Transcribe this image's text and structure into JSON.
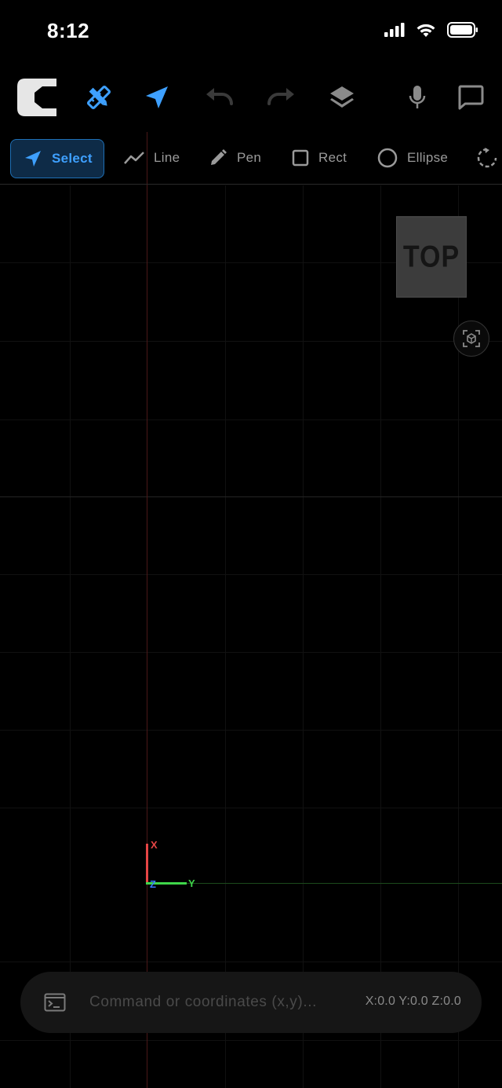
{
  "status_bar": {
    "time": "8:12"
  },
  "toolbar": {
    "buttons": [
      {
        "name": "app-logo",
        "icon": "logo-c"
      },
      {
        "name": "design-tools",
        "icon": "ruler-pencil-icon"
      },
      {
        "name": "navigate",
        "icon": "arrow-icon"
      },
      {
        "name": "undo",
        "icon": "undo-icon"
      },
      {
        "name": "redo",
        "icon": "redo-icon"
      },
      {
        "name": "layers",
        "icon": "layers-icon"
      },
      {
        "name": "microphone",
        "icon": "mic-icon"
      },
      {
        "name": "chat",
        "icon": "chat-icon"
      }
    ]
  },
  "tools": {
    "select": "Select",
    "line": "Line",
    "pen": "Pen",
    "rect": "Rect",
    "ellipse": "Ellipse"
  },
  "viewport": {
    "view_cube_label": "TOP",
    "gizmo": {
      "x": "X",
      "y": "Y",
      "z": "Z"
    }
  },
  "command": {
    "placeholder": "Command or coordinates (x,y)...",
    "value": "",
    "coords": "X:0.0 Y:0.0 Z:0.0"
  },
  "colors": {
    "accent": "#3ea0ff",
    "axis_x": "#e64545",
    "axis_y": "#3fd64a",
    "axis_z": "#3a7bff",
    "background": "#000000"
  }
}
